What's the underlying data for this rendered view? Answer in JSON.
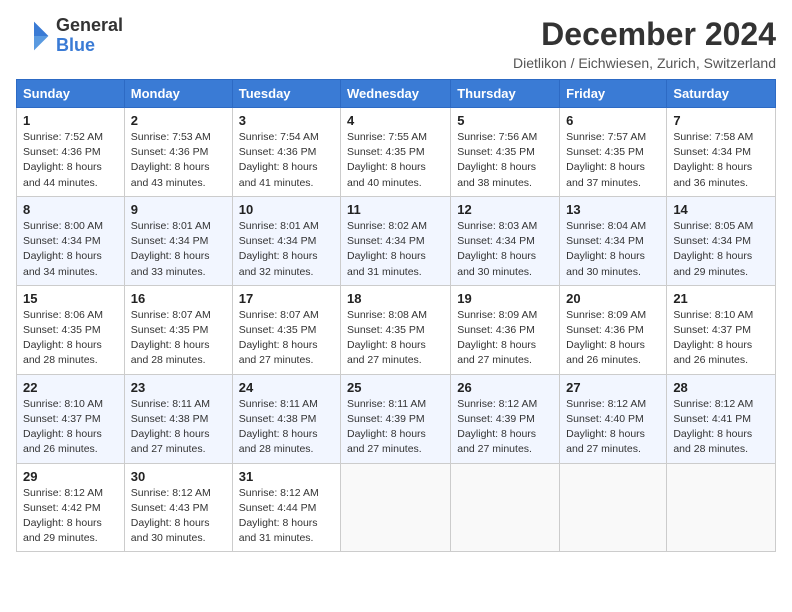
{
  "logo": {
    "general": "General",
    "blue": "Blue"
  },
  "header": {
    "month": "December 2024",
    "location": "Dietlikon / Eichwiesen, Zurich, Switzerland"
  },
  "weekdays": [
    "Sunday",
    "Monday",
    "Tuesday",
    "Wednesday",
    "Thursday",
    "Friday",
    "Saturday"
  ],
  "weeks": [
    [
      {
        "day": "1",
        "sunrise": "7:52 AM",
        "sunset": "4:36 PM",
        "daylight": "8 hours and 44 minutes."
      },
      {
        "day": "2",
        "sunrise": "7:53 AM",
        "sunset": "4:36 PM",
        "daylight": "8 hours and 43 minutes."
      },
      {
        "day": "3",
        "sunrise": "7:54 AM",
        "sunset": "4:36 PM",
        "daylight": "8 hours and 41 minutes."
      },
      {
        "day": "4",
        "sunrise": "7:55 AM",
        "sunset": "4:35 PM",
        "daylight": "8 hours and 40 minutes."
      },
      {
        "day": "5",
        "sunrise": "7:56 AM",
        "sunset": "4:35 PM",
        "daylight": "8 hours and 38 minutes."
      },
      {
        "day": "6",
        "sunrise": "7:57 AM",
        "sunset": "4:35 PM",
        "daylight": "8 hours and 37 minutes."
      },
      {
        "day": "7",
        "sunrise": "7:58 AM",
        "sunset": "4:34 PM",
        "daylight": "8 hours and 36 minutes."
      }
    ],
    [
      {
        "day": "8",
        "sunrise": "8:00 AM",
        "sunset": "4:34 PM",
        "daylight": "8 hours and 34 minutes."
      },
      {
        "day": "9",
        "sunrise": "8:01 AM",
        "sunset": "4:34 PM",
        "daylight": "8 hours and 33 minutes."
      },
      {
        "day": "10",
        "sunrise": "8:01 AM",
        "sunset": "4:34 PM",
        "daylight": "8 hours and 32 minutes."
      },
      {
        "day": "11",
        "sunrise": "8:02 AM",
        "sunset": "4:34 PM",
        "daylight": "8 hours and 31 minutes."
      },
      {
        "day": "12",
        "sunrise": "8:03 AM",
        "sunset": "4:34 PM",
        "daylight": "8 hours and 30 minutes."
      },
      {
        "day": "13",
        "sunrise": "8:04 AM",
        "sunset": "4:34 PM",
        "daylight": "8 hours and 30 minutes."
      },
      {
        "day": "14",
        "sunrise": "8:05 AM",
        "sunset": "4:34 PM",
        "daylight": "8 hours and 29 minutes."
      }
    ],
    [
      {
        "day": "15",
        "sunrise": "8:06 AM",
        "sunset": "4:35 PM",
        "daylight": "8 hours and 28 minutes."
      },
      {
        "day": "16",
        "sunrise": "8:07 AM",
        "sunset": "4:35 PM",
        "daylight": "8 hours and 28 minutes."
      },
      {
        "day": "17",
        "sunrise": "8:07 AM",
        "sunset": "4:35 PM",
        "daylight": "8 hours and 27 minutes."
      },
      {
        "day": "18",
        "sunrise": "8:08 AM",
        "sunset": "4:35 PM",
        "daylight": "8 hours and 27 minutes."
      },
      {
        "day": "19",
        "sunrise": "8:09 AM",
        "sunset": "4:36 PM",
        "daylight": "8 hours and 27 minutes."
      },
      {
        "day": "20",
        "sunrise": "8:09 AM",
        "sunset": "4:36 PM",
        "daylight": "8 hours and 26 minutes."
      },
      {
        "day": "21",
        "sunrise": "8:10 AM",
        "sunset": "4:37 PM",
        "daylight": "8 hours and 26 minutes."
      }
    ],
    [
      {
        "day": "22",
        "sunrise": "8:10 AM",
        "sunset": "4:37 PM",
        "daylight": "8 hours and 26 minutes."
      },
      {
        "day": "23",
        "sunrise": "8:11 AM",
        "sunset": "4:38 PM",
        "daylight": "8 hours and 27 minutes."
      },
      {
        "day": "24",
        "sunrise": "8:11 AM",
        "sunset": "4:38 PM",
        "daylight": "8 hours and 28 minutes."
      },
      {
        "day": "25",
        "sunrise": "8:11 AM",
        "sunset": "4:39 PM",
        "daylight": "8 hours and 27 minutes."
      },
      {
        "day": "26",
        "sunrise": "8:12 AM",
        "sunset": "4:39 PM",
        "daylight": "8 hours and 27 minutes."
      },
      {
        "day": "27",
        "sunrise": "8:12 AM",
        "sunset": "4:40 PM",
        "daylight": "8 hours and 27 minutes."
      },
      {
        "day": "28",
        "sunrise": "8:12 AM",
        "sunset": "4:41 PM",
        "daylight": "8 hours and 28 minutes."
      }
    ],
    [
      {
        "day": "29",
        "sunrise": "8:12 AM",
        "sunset": "4:42 PM",
        "daylight": "8 hours and 29 minutes."
      },
      {
        "day": "30",
        "sunrise": "8:12 AM",
        "sunset": "4:43 PM",
        "daylight": "8 hours and 30 minutes."
      },
      {
        "day": "31",
        "sunrise": "8:12 AM",
        "sunset": "4:44 PM",
        "daylight": "8 hours and 31 minutes."
      },
      null,
      null,
      null,
      null
    ]
  ],
  "labels": {
    "sunrise": "Sunrise:",
    "sunset": "Sunset:",
    "daylight": "Daylight:"
  },
  "colors": {
    "header_bg": "#3a7bd5",
    "alt_row": "#f2f6ff"
  }
}
